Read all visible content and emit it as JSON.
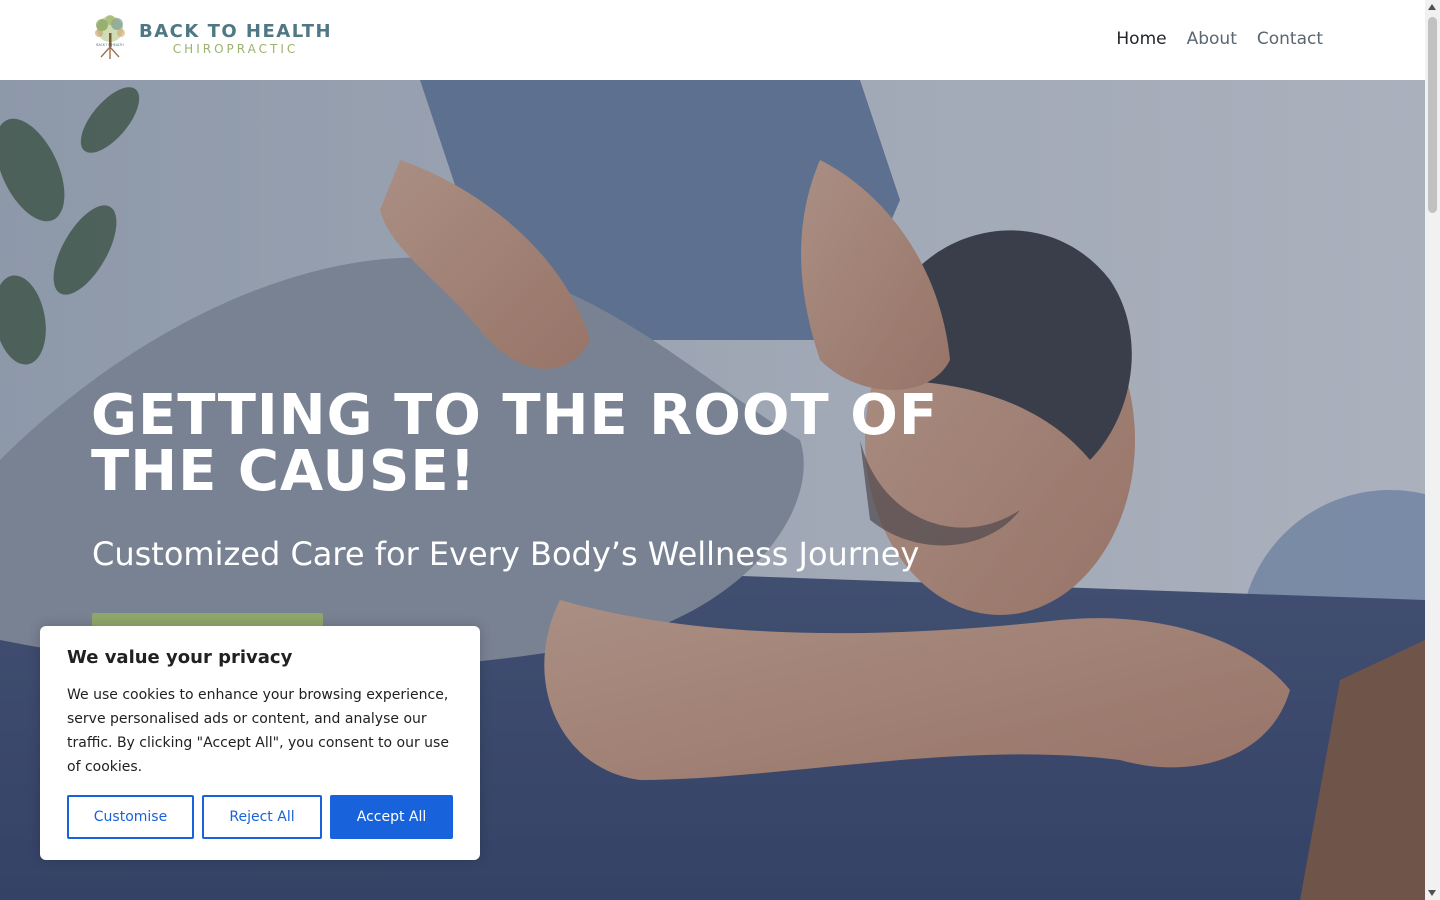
{
  "header": {
    "logo": {
      "main": "BACK TO HEALTH",
      "sub": "CHIROPRACTIC",
      "tree_small": "BACK TO HEALTH"
    },
    "nav": [
      {
        "label": "Home",
        "active": true
      },
      {
        "label": "About",
        "active": false
      },
      {
        "label": "Contact",
        "active": false
      }
    ]
  },
  "hero": {
    "title": "GETTING TO THE ROOT OF THE CAUSE!",
    "subtitle": "Customized Care for Every Body’s Wellness Journey",
    "button_color": "#8fa86a"
  },
  "cookie": {
    "title": "We value your privacy",
    "text": "We use cookies to enhance your browsing experience, serve personalised ads or content, and analyse our traffic. By clicking \"Accept All\", you consent to our use of cookies.",
    "customise_label": "Customise",
    "reject_label": "Reject All",
    "accept_label": "Accept All",
    "accent": "#1863dc"
  }
}
